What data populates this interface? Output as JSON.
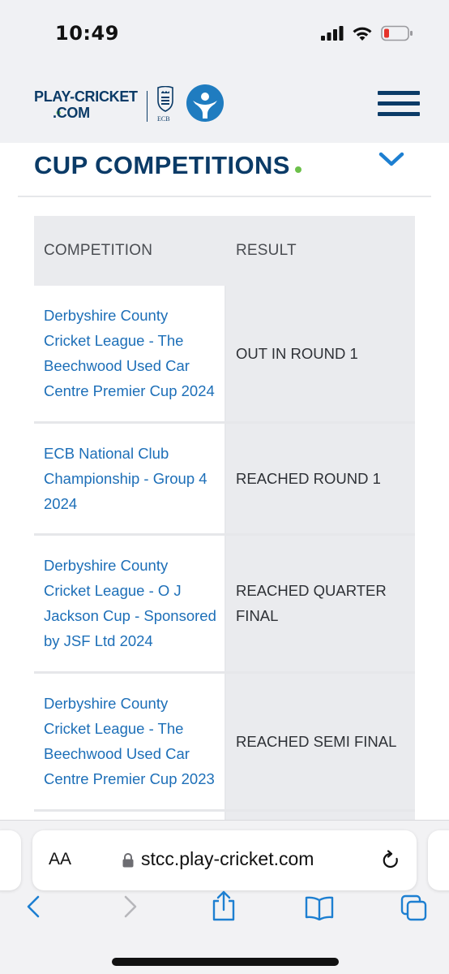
{
  "status_bar": {
    "time": "10:49",
    "icons": [
      "cellular-signal-icon",
      "wifi-icon",
      "battery-low-icon"
    ]
  },
  "header": {
    "logo_line1": "PLAY-CRICKET",
    "logo_line2": ".COM",
    "ecb_label": "ECB",
    "menu_icon": "hamburger-menu-icon",
    "brand_color": "#0b3b67",
    "accent_color": "#6cc04a"
  },
  "section": {
    "title": "CUP COMPETITIONS",
    "toggle_icon": "chevron-down-icon",
    "link_color": "#1d6fb8"
  },
  "table": {
    "columns": [
      "COMPETITION",
      "RESULT"
    ],
    "rows": [
      {
        "competition": "Derbyshire County Cricket League - The Beechwood Used Car Centre Premier Cup 2024",
        "result": "OUT IN ROUND 1"
      },
      {
        "competition": "ECB National Club Championship - Group 4 2024",
        "result": "REACHED ROUND 1"
      },
      {
        "competition": "Derbyshire County Cricket League - O J Jackson Cup - Sponsored by JSF Ltd 2024",
        "result": "REACHED QUARTER FINAL"
      },
      {
        "competition": "Derbyshire County Cricket League - The Beechwood Used Car Centre Premier Cup 2023",
        "result": "REACHED SEMI FINAL"
      }
    ]
  },
  "browser": {
    "aa_label": "AA",
    "url": "stcc.play-cricket.com",
    "toolbar_icons": [
      "back-icon",
      "forward-icon",
      "share-icon",
      "bookmarks-icon",
      "tabs-icon"
    ]
  }
}
